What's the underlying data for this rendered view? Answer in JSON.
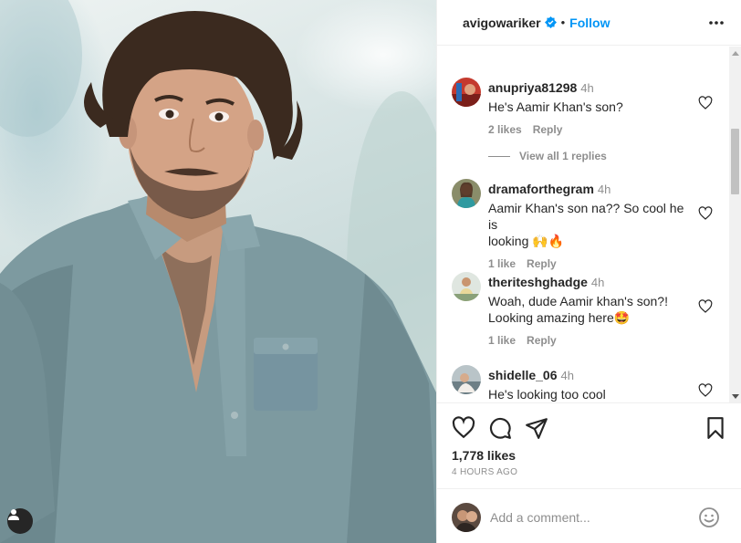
{
  "post": {
    "owner_username": "avigowariker",
    "header_dot": "•",
    "follow_label": "Follow",
    "likes_text": "1,778 likes",
    "time_text": "4 HOURS AGO"
  },
  "comments": [
    {
      "username": "anupriya81298",
      "time": "4h",
      "text_lines": [
        "He's Aamir Khan's son?"
      ],
      "likes": "2 likes",
      "reply_label": "Reply"
    },
    {
      "username": "dramaforthegram",
      "time": "4h",
      "text_lines": [
        "Aamir Khan's son na?? So cool he is",
        "looking 🙌🔥"
      ],
      "likes": "1 like",
      "reply_label": "Reply"
    },
    {
      "username": "theriteshghadge",
      "time": "4h",
      "text_lines": [
        "Woah, dude Aamir khan's son?!",
        "Looking amazing here🤩"
      ],
      "likes": "1 like",
      "reply_label": "Reply"
    },
    {
      "username": "shidelle_06",
      "time": "4h",
      "text_lines": [
        "He's looking too cool"
      ]
    }
  ],
  "view_replies_label": "View all 1 replies",
  "comment_input": {
    "placeholder": "Add a comment..."
  },
  "icons": {
    "verified": "verified-badge-icon",
    "more": "more-options-icon",
    "like": "heart-icon",
    "comment": "comment-bubble-icon",
    "share": "send-icon",
    "save": "bookmark-icon",
    "emoji": "smiley-icon",
    "user_tag": "person-icon"
  },
  "colors": {
    "accent": "#0095f6",
    "text": "#262626",
    "secondary": "#8e8e8e",
    "border": "#efefef"
  }
}
